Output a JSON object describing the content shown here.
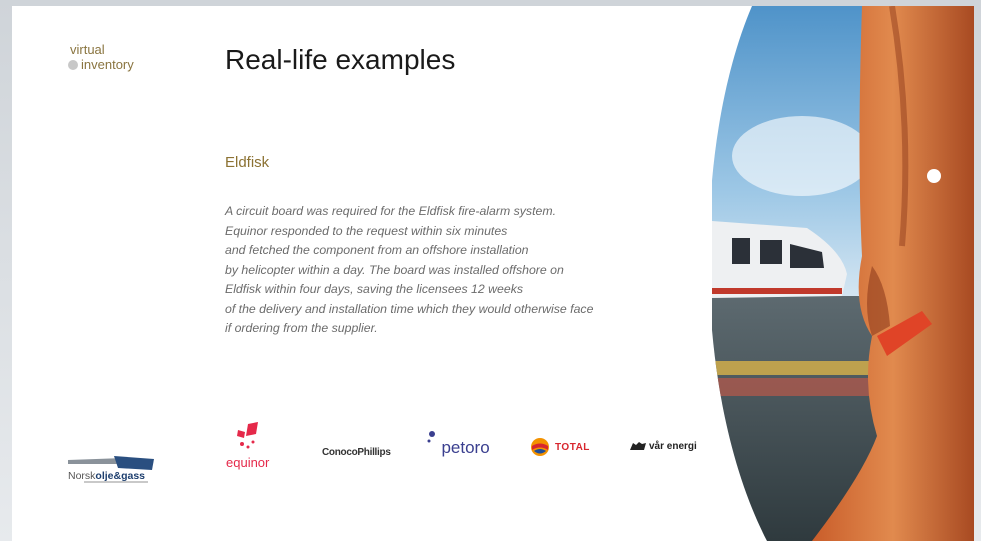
{
  "brand": {
    "line1": "virtual",
    "line2": "inventory"
  },
  "title": "Real-life examples",
  "subtitle": "Eldfisk",
  "body_lines": [
    "A circuit board was required for the Eldfisk fire-alarm system.",
    "Equinor responded to the request within six minutes",
    "and fetched the component from an offshore installation",
    "by helicopter within  a day. The board was installed offshore on",
    "Eldfisk within four days, saving the licensees 12 weeks",
    "of the delivery and installation time which they would otherwise face",
    "if ordering from the supplier."
  ],
  "logos": {
    "equinor": "equinor",
    "conoco": "ConocoPhillips",
    "petoro": "petoro",
    "total": "TOTAL",
    "var_energi": "vår energi",
    "norsk_prefix": "Norsk",
    "norsk_main": "olje&gass"
  },
  "colors": {
    "accent_gold": "#8c7233",
    "equinor_red": "#e5294a",
    "petoro_blue": "#3a3f8f"
  }
}
